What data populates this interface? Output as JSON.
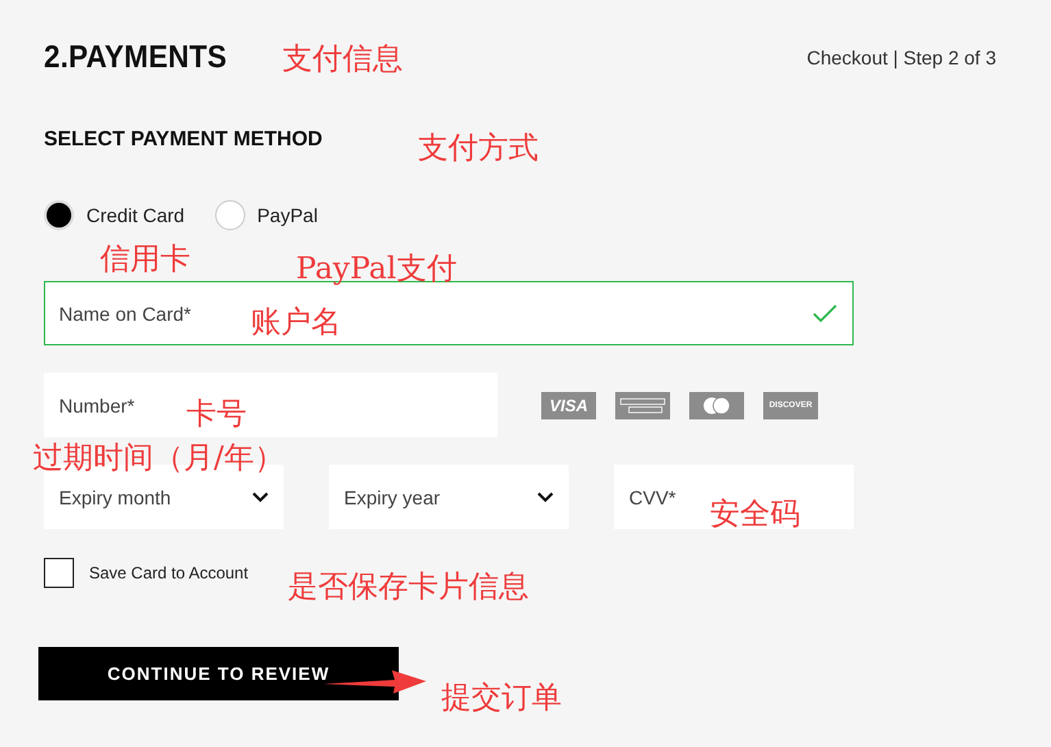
{
  "header": {
    "title": "2.PAYMENTS",
    "step": "Checkout | Step 2 of 3"
  },
  "payment_method": {
    "heading": "SELECT PAYMENT METHOD",
    "options": [
      {
        "label": "Credit Card",
        "selected": true
      },
      {
        "label": "PayPal",
        "selected": false
      }
    ]
  },
  "name_field": {
    "placeholder": "Name on Card*",
    "valid": true
  },
  "number_field": {
    "placeholder": "Number*",
    "valid": false
  },
  "card_logos": [
    {
      "kind": "visa",
      "text": "VISA"
    },
    {
      "kind": "amex"
    },
    {
      "kind": "mastercard"
    },
    {
      "kind": "discover",
      "text": "DISCOVER"
    }
  ],
  "expiry_month": {
    "placeholder": "Expiry month"
  },
  "expiry_year": {
    "placeholder": "Expiry year"
  },
  "cvv_field": {
    "placeholder": "CVV*",
    "valid": false
  },
  "save_card": {
    "label": "Save Card to Account",
    "checked": false
  },
  "submit_button": {
    "label": "CONTINUE TO REVIEW"
  },
  "annotations": [
    {
      "text": "支付信息",
      "kind": "label"
    },
    {
      "text": "支付方式",
      "kind": "label"
    },
    {
      "text": "信用卡",
      "kind": "label"
    },
    {
      "text": "PayPal支付",
      "kind": "label"
    },
    {
      "text": "账户名",
      "kind": "label"
    },
    {
      "text": "卡号",
      "kind": "label"
    },
    {
      "text": "过期时间（月/年）",
      "kind": "label"
    },
    {
      "text": "安全码",
      "kind": "label"
    },
    {
      "text": "是否保存卡片信息",
      "kind": "label"
    },
    {
      "text": "提交订单",
      "kind": "arrow"
    }
  ]
}
